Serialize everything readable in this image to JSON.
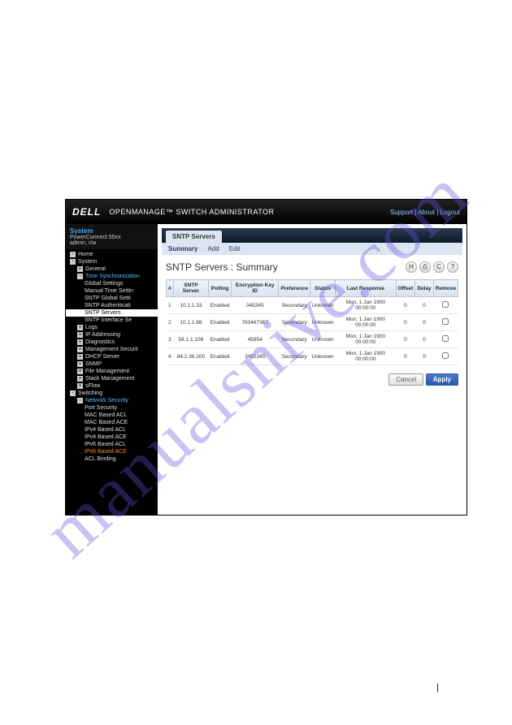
{
  "watermark": "manualsnive.com",
  "header": {
    "logo": "DELL",
    "title": "OPENMANAGE™ SWITCH ADMINISTRATOR",
    "links": {
      "support": "Support",
      "about": "About",
      "logout": "Logout"
    }
  },
  "sidebar": {
    "system_label": "System",
    "device": "PowerConnect 55xx",
    "user": "admin, r/w",
    "items": [
      {
        "lvl": 1,
        "label": "Home",
        "box": "-",
        "cls": ""
      },
      {
        "lvl": 1,
        "label": "System",
        "box": "-",
        "cls": ""
      },
      {
        "lvl": 2,
        "label": "General",
        "box": "+",
        "cls": ""
      },
      {
        "lvl": 2,
        "label": "Time Synchronization",
        "box": "-",
        "cls": "blue"
      },
      {
        "lvl": 3,
        "label": "Global Settings",
        "box": "",
        "cls": ""
      },
      {
        "lvl": 3,
        "label": "Manual Time Settin",
        "box": "",
        "cls": ""
      },
      {
        "lvl": 3,
        "label": "SNTP Global Setti",
        "box": "",
        "cls": ""
      },
      {
        "lvl": 3,
        "label": "SNTP Authenticati",
        "box": "",
        "cls": ""
      },
      {
        "lvl": 3,
        "label": "SNTP Servers",
        "box": "",
        "cls": "active"
      },
      {
        "lvl": 3,
        "label": "SNTP Interface Se",
        "box": "",
        "cls": ""
      },
      {
        "lvl": 2,
        "label": "Logs",
        "box": "+",
        "cls": ""
      },
      {
        "lvl": 2,
        "label": "IP Addressing",
        "box": "+",
        "cls": ""
      },
      {
        "lvl": 2,
        "label": "Diagnostics",
        "box": "+",
        "cls": ""
      },
      {
        "lvl": 2,
        "label": "Management Securit",
        "box": "+",
        "cls": ""
      },
      {
        "lvl": 2,
        "label": "DHCP Server",
        "box": "+",
        "cls": ""
      },
      {
        "lvl": 2,
        "label": "SNMP",
        "box": "+",
        "cls": ""
      },
      {
        "lvl": 2,
        "label": "File Management",
        "box": "+",
        "cls": ""
      },
      {
        "lvl": 2,
        "label": "Stack Management",
        "box": "+",
        "cls": ""
      },
      {
        "lvl": 2,
        "label": "sFlow",
        "box": "+",
        "cls": ""
      },
      {
        "lvl": 1,
        "label": "Switching",
        "box": "-",
        "cls": ""
      },
      {
        "lvl": 2,
        "label": "Network Security",
        "box": "-",
        "cls": "blue"
      },
      {
        "lvl": 3,
        "label": "Port Security",
        "box": "",
        "cls": ""
      },
      {
        "lvl": 3,
        "label": "MAC Based ACL",
        "box": "",
        "cls": ""
      },
      {
        "lvl": 3,
        "label": "MAC Based ACE",
        "box": "",
        "cls": ""
      },
      {
        "lvl": 3,
        "label": "IPv4 Based ACL",
        "box": "",
        "cls": ""
      },
      {
        "lvl": 3,
        "label": "IPv4 Based ACE",
        "box": "",
        "cls": ""
      },
      {
        "lvl": 3,
        "label": "IPv6 Based ACL",
        "box": "",
        "cls": ""
      },
      {
        "lvl": 3,
        "label": "IPv6 Based ACE",
        "box": "",
        "cls": "orange"
      },
      {
        "lvl": 3,
        "label": "ACL Binding",
        "box": "",
        "cls": ""
      }
    ]
  },
  "tabs": {
    "main": "SNTP Servers",
    "sub": [
      "Summary",
      "Add",
      "Edit"
    ]
  },
  "page_title": "SNTP Servers : Summary",
  "toolbar": {
    "save": "H",
    "print": "print",
    "refresh": "C",
    "help": "?"
  },
  "table": {
    "headers": [
      "#",
      "SNTP Server",
      "Polling",
      "Encryption Key ID",
      "Preference",
      "Status",
      "Last Response",
      "Offset",
      "Delay",
      "Remove"
    ],
    "rows": [
      {
        "n": "1",
        "server": "10.1.1.33",
        "polling": "Enabled",
        "key": "345345",
        "pref": "Secondary",
        "status": "Unknown",
        "last": "Mon, 1 Jan 1900 00:00:00",
        "offset": "0",
        "delay": "0"
      },
      {
        "n": "2",
        "server": "10.1.1.66",
        "polling": "Enabled",
        "key": "763467367",
        "pref": "Secondary",
        "status": "Unknown",
        "last": "Mon, 1 Jan 1900 00:00:00",
        "offset": "0",
        "delay": "0"
      },
      {
        "n": "3",
        "server": "58.1.1.108",
        "polling": "Enabled",
        "key": "45954",
        "pref": "Secondary",
        "status": "Unknown",
        "last": "Mon, 1 Jan 1900 00:00:00",
        "offset": "0",
        "delay": "0"
      },
      {
        "n": "4",
        "server": "84.2.36.200",
        "polling": "Enabled",
        "key": "3452345",
        "pref": "Secondary",
        "status": "Unknown",
        "last": "Mon, 1 Jan 1900 00:00:00",
        "offset": "0",
        "delay": "0"
      }
    ]
  },
  "buttons": {
    "cancel": "Cancel",
    "apply": "Apply"
  },
  "page_num": "|"
}
